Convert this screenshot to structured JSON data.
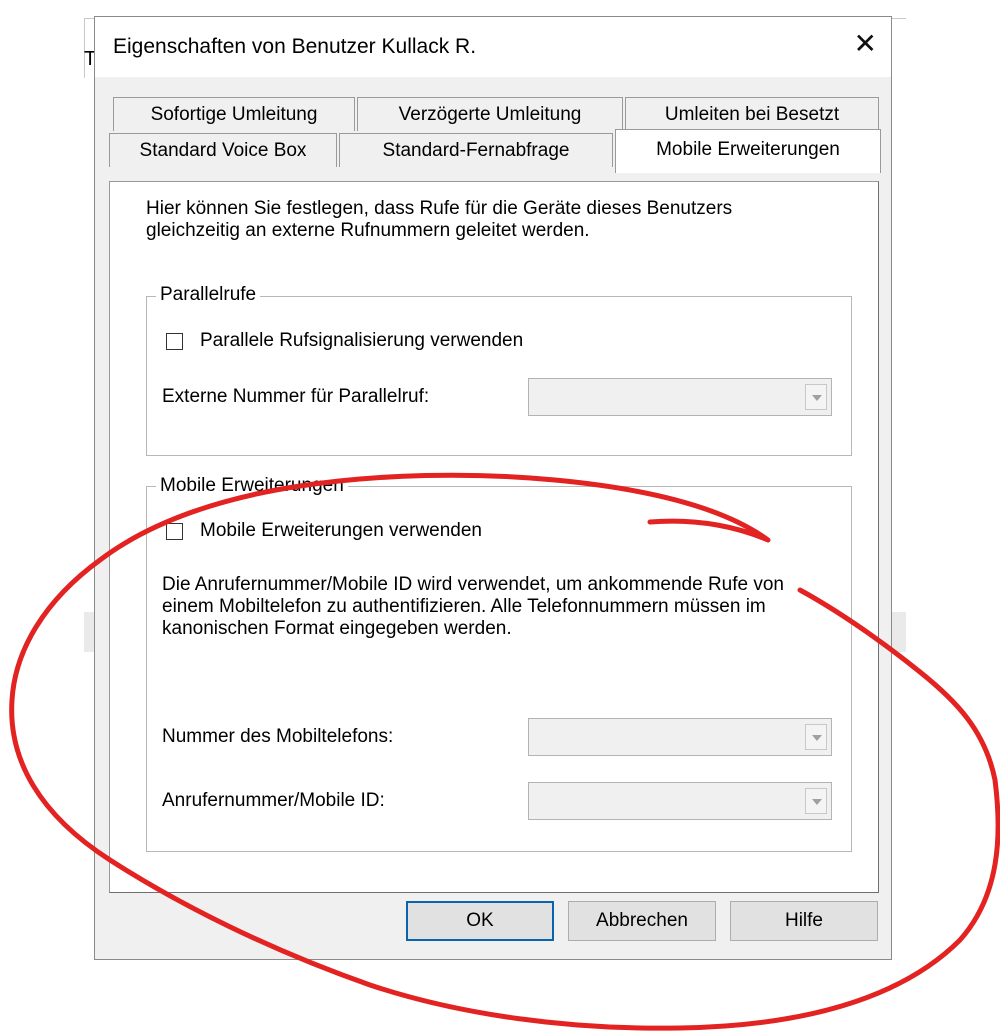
{
  "background": {
    "window_glyph": "T"
  },
  "dialog": {
    "title": "Eigenschaften von Benutzer Kullack R.",
    "close_icon": "close-icon",
    "tabs_row1": [
      "Sofortige Umleitung",
      "Verzögerte Umleitung",
      "Umleiten bei Besetzt"
    ],
    "tabs_row2": [
      "Standard Voice Box",
      "Standard-Fernabfrage",
      "Mobile Erweiterungen"
    ],
    "active_tab": "Mobile Erweiterungen",
    "intro": "Hier können Sie festlegen, dass Rufe für die Geräte dieses Benutzers gleichzeitig an externe Rufnummern geleitet werden.",
    "parallel_group": {
      "label": "Parallelrufe",
      "checkbox_label": "Parallele Rufsignalisierung verwenden",
      "checked": false,
      "field_label": "Externe Nummer für Parallelruf:",
      "field_value": ""
    },
    "mobile_group": {
      "label": "Mobile Erweiterungen",
      "checkbox_label": "Mobile Erweiterungen verwenden",
      "checked": false,
      "description": "Die Anrufernummer/Mobile ID wird verwendet, um ankommende Rufe von einem Mobiltelefon zu authentifizieren. Alle Telefonnummern müssen im kanonischen Format eingegeben werden.",
      "phone_label": "Nummer des Mobiltelefons:",
      "phone_value": "",
      "caller_label": "Anrufernummer/Mobile ID:",
      "caller_value": ""
    },
    "buttons": {
      "ok": "OK",
      "cancel": "Abbrechen",
      "help": "Hilfe"
    }
  },
  "colors": {
    "annotation": "#e32222",
    "default_button_border": "#0a64ad"
  }
}
